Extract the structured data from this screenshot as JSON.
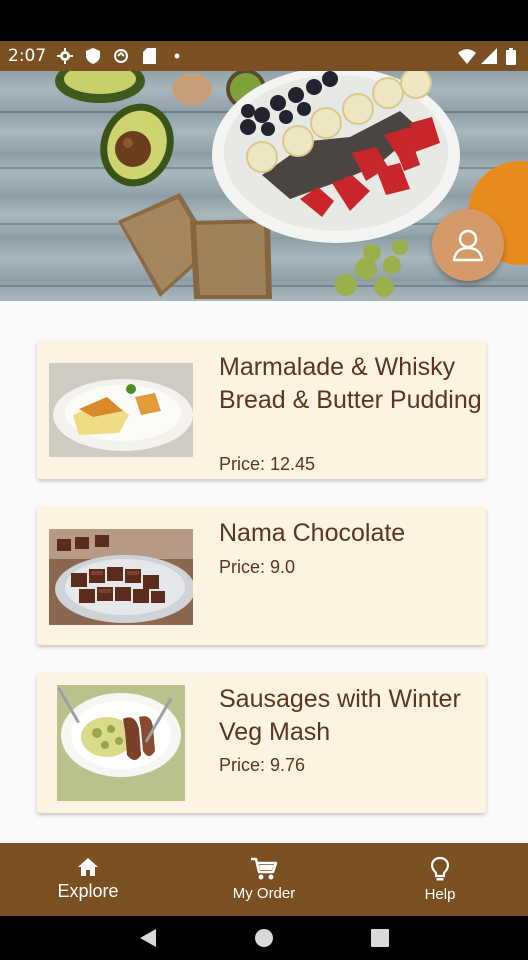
{
  "status_bar": {
    "time": "2:07",
    "left_icons": [
      "settings-icon",
      "shield-icon",
      "sync-icon",
      "sd-card-icon",
      "dot-icon"
    ],
    "right_icons": [
      "wifi-icon",
      "signal-icon",
      "battery-icon"
    ]
  },
  "colors": {
    "brand_brown": "#7a4f22",
    "card_bg": "#fdf3e3",
    "fab": "#d49a6a",
    "text_brown": "#5a3520"
  },
  "hero": {
    "profile_button_icon": "user-icon"
  },
  "menu_items": [
    {
      "title": "Marmalade & Whisky Bread & Butter Pudding",
      "price": "Price: 12.45",
      "image": "pudding-plate"
    },
    {
      "title": "Nama Chocolate",
      "price": "Price: 9.0",
      "image": "chocolate-tray"
    },
    {
      "title": "Sausages with Winter Veg Mash",
      "price": "Price: 9.76",
      "image": "sausage-plate"
    }
  ],
  "bottom_nav": [
    {
      "label": "Explore",
      "icon": "home-icon",
      "active": true
    },
    {
      "label": "My Order",
      "icon": "cart-icon",
      "active": false
    },
    {
      "label": "Help",
      "icon": "lightbulb-icon",
      "active": false
    }
  ],
  "system_nav": [
    "back-icon",
    "home-circle-icon",
    "recents-icon"
  ]
}
